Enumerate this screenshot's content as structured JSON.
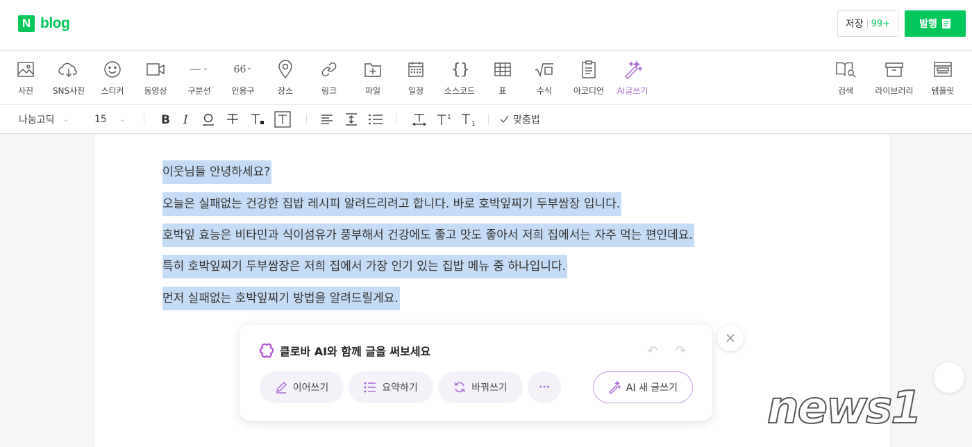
{
  "header": {
    "logo_letter": "N",
    "logo_text": "blog",
    "save_label": "저장",
    "save_count": "99+",
    "publish_label": "발행"
  },
  "toolbar": {
    "items": [
      {
        "label": "사진",
        "icon": "photo-icon"
      },
      {
        "label": "SNS사진",
        "icon": "cloud-download-icon"
      },
      {
        "label": "스티커",
        "icon": "smiley-icon"
      },
      {
        "label": "동영상",
        "icon": "video-icon"
      },
      {
        "label": "구분선",
        "icon": "divider-icon"
      },
      {
        "label": "인용구",
        "icon": "quote-icon"
      },
      {
        "label": "장소",
        "icon": "map-pin-icon"
      },
      {
        "label": "링크",
        "icon": "link-icon"
      },
      {
        "label": "파일",
        "icon": "folder-plus-icon"
      },
      {
        "label": "일정",
        "icon": "calendar-icon"
      },
      {
        "label": "소스코드",
        "icon": "code-braces-icon"
      },
      {
        "label": "표",
        "icon": "table-icon"
      },
      {
        "label": "수식",
        "icon": "sqrt-icon"
      },
      {
        "label": "아코디언",
        "icon": "accordion-icon"
      },
      {
        "label": "AI글쓰기",
        "icon": "ai-wand-icon"
      }
    ],
    "right_items": [
      {
        "label": "검색",
        "icon": "book-search-icon"
      },
      {
        "label": "라이브러리",
        "icon": "archive-icon"
      },
      {
        "label": "템플릿",
        "icon": "template-icon"
      }
    ]
  },
  "format": {
    "font_family": "나눔고딕",
    "font_size": "15",
    "spell_check": "맞춤법"
  },
  "document": {
    "lines": [
      "이웃님들 안녕하세요?",
      "오늘은 실패없는 건강한 집밥 레시피 알려드리려고 합니다. 바로 호박잎찌기 두부쌈장 입니다.",
      "호박잎 효능은 비타민과 식이섬유가 풍부해서 건강에도 좋고 맛도 좋아서 저희 집에서는 자주 먹는 편인데요.",
      "특히 호박잎찌기 두부쌈장은 저희 집에서 가장 인기 있는 집밥 메뉴 중 하나입니다.",
      "먼저 실패없는 호박잎찌기 방법을 알려드릴게요."
    ],
    "selection_color": "#c5dcf6"
  },
  "ai_panel": {
    "title": "클로바 AI와 함께 글을 써보세요",
    "buttons": {
      "continue": "이어쓰기",
      "summarize": "요약하기",
      "rewrite": "바꿔쓰기",
      "more": "···",
      "new_writing": "AI 새 글쓰기"
    }
  },
  "watermark": "news1",
  "colors": {
    "brand": "#03c75a",
    "ai_accent": "#a86bd6"
  }
}
